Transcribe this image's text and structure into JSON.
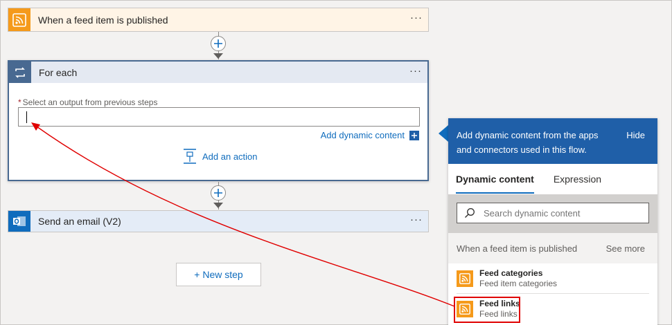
{
  "steps": {
    "trigger": {
      "title": "When a feed item is published",
      "more": "···"
    },
    "foreach": {
      "title": "For each",
      "more": "···",
      "field_label": "Select an output from previous steps",
      "required_mark": "*",
      "add_dynamic": "Add dynamic content",
      "add_action": "Add an action"
    },
    "email": {
      "title": "Send an email (V2)",
      "more": "···"
    },
    "new_step": "+ New step"
  },
  "panel": {
    "description": "Add dynamic content from the apps and connectors used in this flow.",
    "hide": "Hide",
    "tabs": [
      "Dynamic content",
      "Expression"
    ],
    "search_placeholder": "Search dynamic content",
    "section": {
      "title": "When a feed item is published",
      "see_more": "See more"
    },
    "items": [
      {
        "title": "Feed categories",
        "subtitle": "Feed item categories"
      },
      {
        "title": "Feed links",
        "subtitle": "Feed links"
      }
    ]
  },
  "colors": {
    "rss": "#f59a1b",
    "loop": "#486991",
    "outlook": "#0f6cbd",
    "accent": "#0f6cbd",
    "panel_header": "#1f5fa8",
    "annotation": "#e00000"
  }
}
